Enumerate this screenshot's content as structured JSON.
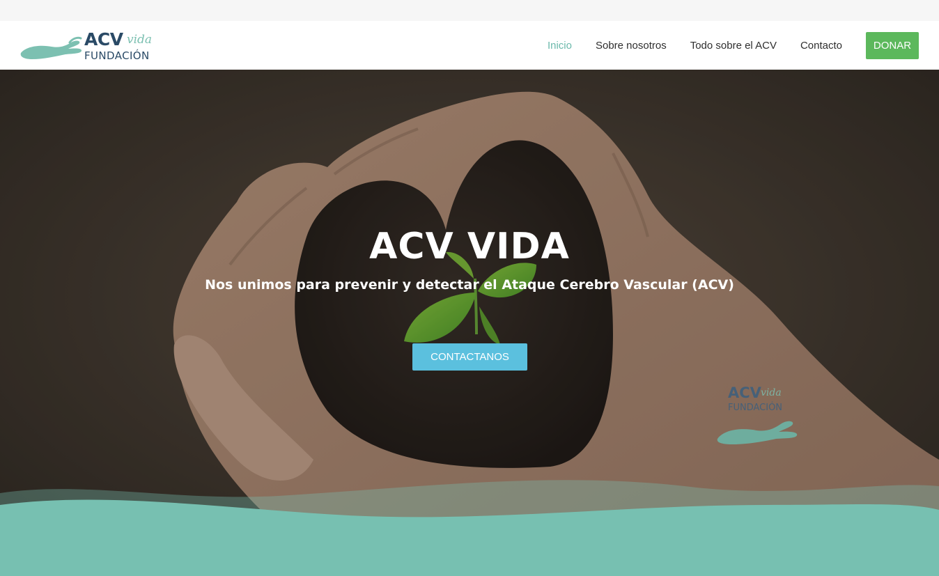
{
  "brand": {
    "acv": "ACV",
    "vida": "vida",
    "fundacion": "FUNDACIÓN"
  },
  "nav": {
    "items": [
      {
        "label": "Inicio",
        "active": true
      },
      {
        "label": "Sobre nosotros",
        "active": false
      },
      {
        "label": "Todo sobre el ACV",
        "active": false
      },
      {
        "label": "Contacto",
        "active": false
      }
    ],
    "donate_label": "DONAR"
  },
  "hero": {
    "title": "ACV VIDA",
    "subtitle": "Nos unimos para prevenir y detectar el Ataque Cerebro Vascular (ACV)",
    "cta_label": "CONTACTANOS"
  },
  "colors": {
    "accent_teal": "#6bb9ab",
    "donate_green": "#5cb85c",
    "cta_blue": "#5bc0de",
    "wave_teal": "#77c0b1",
    "brand_navy": "#2a4a66"
  }
}
